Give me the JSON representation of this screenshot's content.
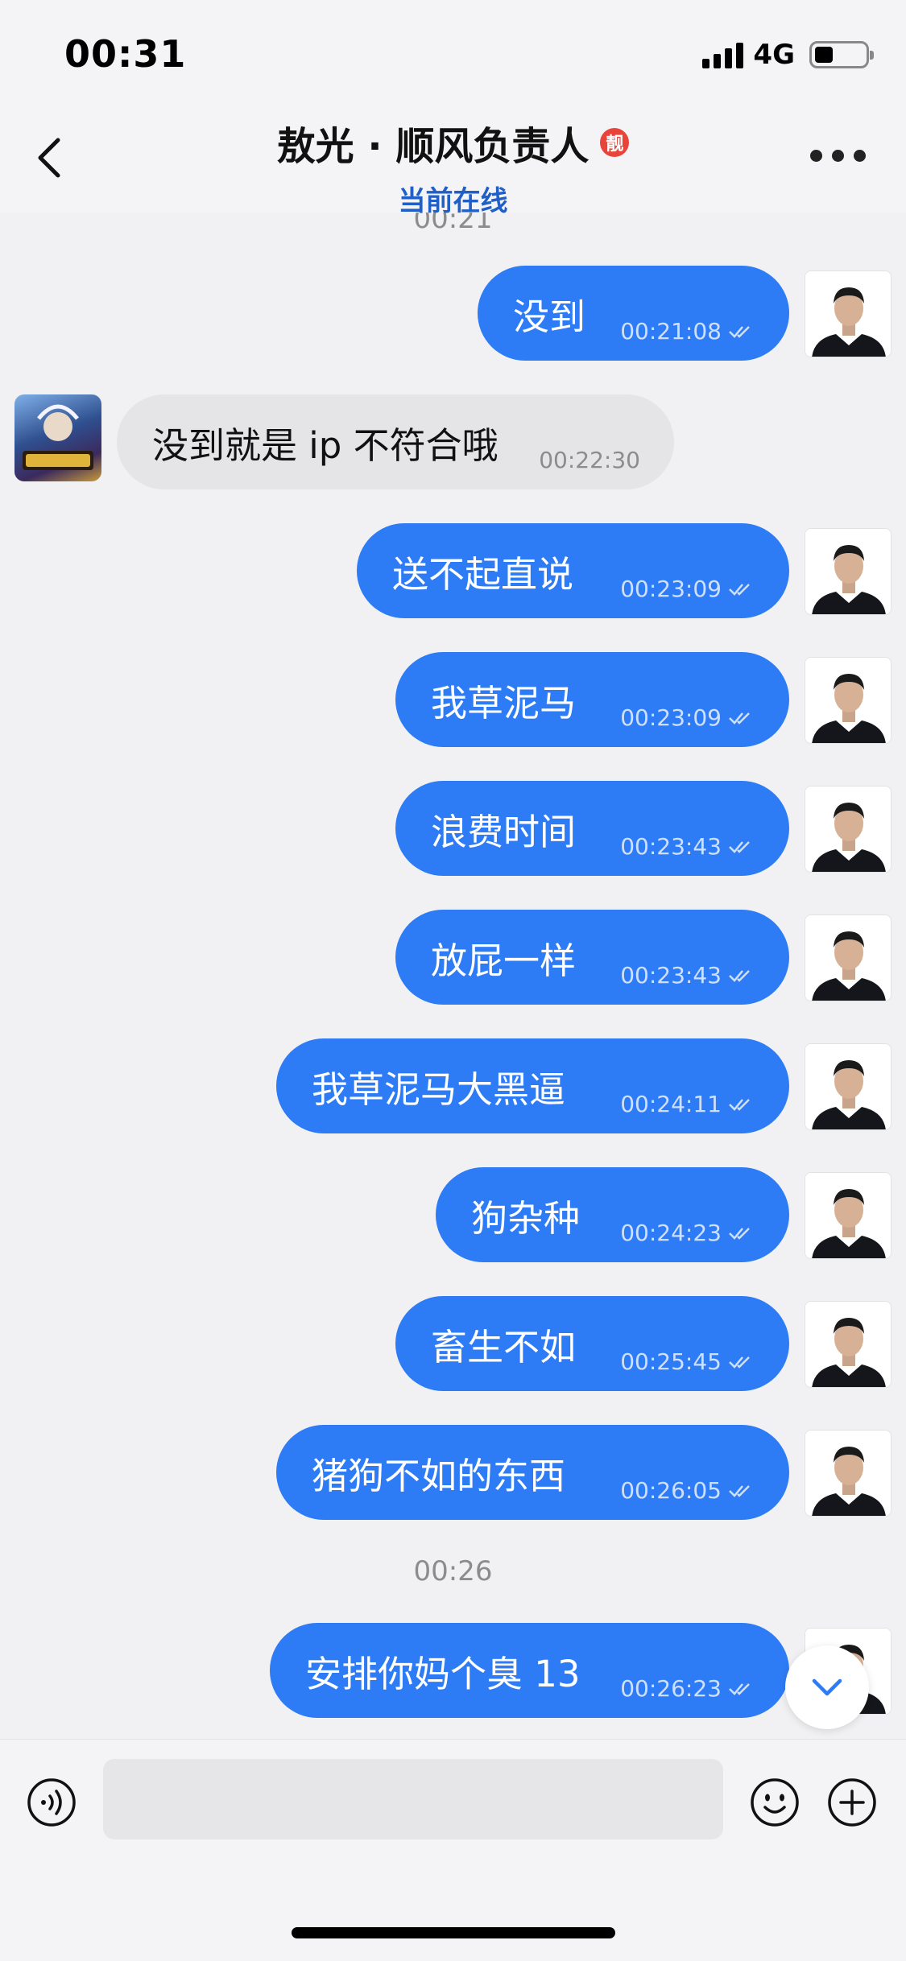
{
  "status_bar": {
    "time": "00:31",
    "network": "4G"
  },
  "header": {
    "title": "敖光 · 顺风负责人",
    "badge": "靓",
    "subtitle": "当前在线"
  },
  "messages": [
    {
      "type": "timestamp",
      "text": "00:21"
    },
    {
      "type": "out",
      "text": "没到",
      "time": "00:21:08"
    },
    {
      "type": "in",
      "text": "没到就是 ip 不符合哦",
      "time": "00:22:30"
    },
    {
      "type": "out",
      "text": "送不起直说",
      "time": "00:23:09"
    },
    {
      "type": "out",
      "text": "我草泥马",
      "time": "00:23:09"
    },
    {
      "type": "out",
      "text": "浪费时间",
      "time": "00:23:43"
    },
    {
      "type": "out",
      "text": "放屁一样",
      "time": "00:23:43"
    },
    {
      "type": "out",
      "text": "我草泥马大黑逼",
      "time": "00:24:11"
    },
    {
      "type": "out",
      "text": "狗杂种",
      "time": "00:24:23"
    },
    {
      "type": "out",
      "text": "畜生不如",
      "time": "00:25:45"
    },
    {
      "type": "out",
      "text": "猪狗不如的东西",
      "time": "00:26:05"
    },
    {
      "type": "timestamp",
      "text": "00:26"
    },
    {
      "type": "out",
      "text": "安排你妈个臭 13",
      "time": "00:26:23"
    }
  ],
  "icons": {
    "back": "chevron-left-icon",
    "more": "ellipsis-icon",
    "voice": "voice-icon",
    "emoji": "emoji-icon",
    "plus": "plus-icon",
    "read": "double-check-icon",
    "scroll": "chevron-down-icon"
  },
  "colors": {
    "out_bubble": "#2d7cf6",
    "in_bubble": "#e5e5e7",
    "subtitle": "#1f5fc7"
  }
}
